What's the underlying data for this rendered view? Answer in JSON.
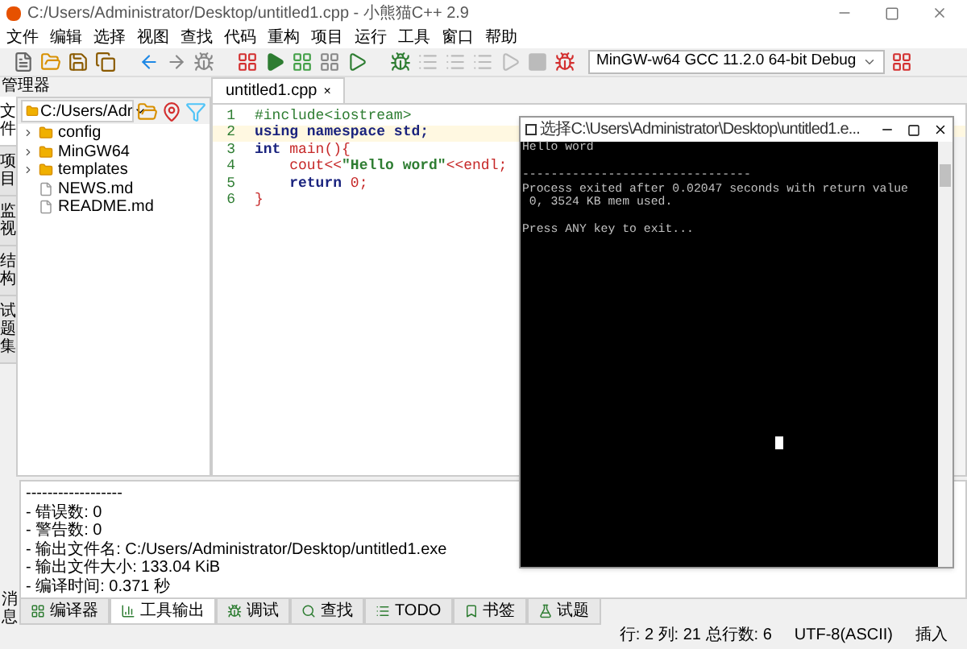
{
  "window": {
    "title": "C:/Users/Administrator/Desktop/untitled1.cpp - 小熊猫C++ 2.9"
  },
  "menu": [
    "文件",
    "编辑",
    "选择",
    "视图",
    "查找",
    "代码",
    "重构",
    "项目",
    "运行",
    "工具",
    "窗口",
    "帮助"
  ],
  "compiler": {
    "value": "MinGW-w64 GCC 11.2.0 64-bit Debug"
  },
  "manager": {
    "title": "管理器",
    "path": "C:/Users/Adr",
    "side_tabs": [
      {
        "label": "文件",
        "selected": true
      },
      {
        "label": "项目",
        "selected": false
      },
      {
        "label": "监视",
        "selected": false
      },
      {
        "label": "结构",
        "selected": false
      },
      {
        "label": "试题集",
        "selected": false
      }
    ],
    "tree": [
      {
        "name": "config",
        "kind": "folder",
        "expanded": false
      },
      {
        "name": "MinGW64",
        "kind": "folder",
        "expanded": false
      },
      {
        "name": "templates",
        "kind": "folder",
        "expanded": false
      },
      {
        "name": "NEWS.md",
        "kind": "file"
      },
      {
        "name": "README.md",
        "kind": "file"
      }
    ]
  },
  "editor": {
    "tabs": [
      {
        "label": "untitled1.cpp",
        "close": "×",
        "selected": true
      }
    ],
    "lines": [
      {
        "number": "1",
        "current": false,
        "tokens": [
          {
            "text": "#include<iostream>",
            "kind": "preproc"
          }
        ]
      },
      {
        "number": "2",
        "current": true,
        "tokens": [
          {
            "text": "using namespace std;",
            "kind": "keyword"
          }
        ]
      },
      {
        "number": "3",
        "current": false,
        "tokens": [
          {
            "text": "int",
            "kind": "keyword"
          },
          {
            "text": " main(){",
            "kind": "plain"
          }
        ]
      },
      {
        "number": "4",
        "current": false,
        "tokens": [
          {
            "text": "    cout<<",
            "kind": "plain"
          },
          {
            "text": "\"Hello word\"",
            "kind": "string"
          },
          {
            "text": "<<endl;",
            "kind": "plain"
          }
        ]
      },
      {
        "number": "5",
        "current": false,
        "tokens": [
          {
            "text": "    return",
            "kind": "keyword"
          },
          {
            "text": " 0;",
            "kind": "plain"
          }
        ]
      },
      {
        "number": "6",
        "current": false,
        "tokens": [
          {
            "text": "}",
            "kind": "plain"
          }
        ]
      }
    ]
  },
  "console": {
    "title": "选择C:\\Users\\Administrator\\Desktop\\untitled1.e...",
    "blocks": [
      [
        "Hello word"
      ],
      [
        "--------------------------------",
        "Process exited after 0.02047 seconds with return value",
        " 0, 3524 KB mem used."
      ],
      [
        "Press ANY key to exit..."
      ]
    ]
  },
  "messages": {
    "side_label": "消息",
    "lines": [
      "------------------",
      "- 错误数: 0",
      "- 警告数: 0",
      "- 输出文件名: C:/Users/Administrator/Desktop/untitled1.exe",
      "- 输出文件大小: 133.04 KiB",
      "- 编译时间: 0.371 秒"
    ],
    "tabs": [
      {
        "label": "编译器",
        "selected": false
      },
      {
        "label": "工具输出",
        "selected": true
      },
      {
        "label": "调试",
        "selected": false
      },
      {
        "label": "查找",
        "selected": false
      },
      {
        "label": "TODO",
        "selected": false
      },
      {
        "label": "书签",
        "selected": false
      },
      {
        "label": "试题",
        "selected": false
      }
    ]
  },
  "status_bar": {
    "position": "行: 2 列: 21 总行数: 6",
    "encoding": "UTF-8(ASCII)",
    "mode": "插入"
  }
}
